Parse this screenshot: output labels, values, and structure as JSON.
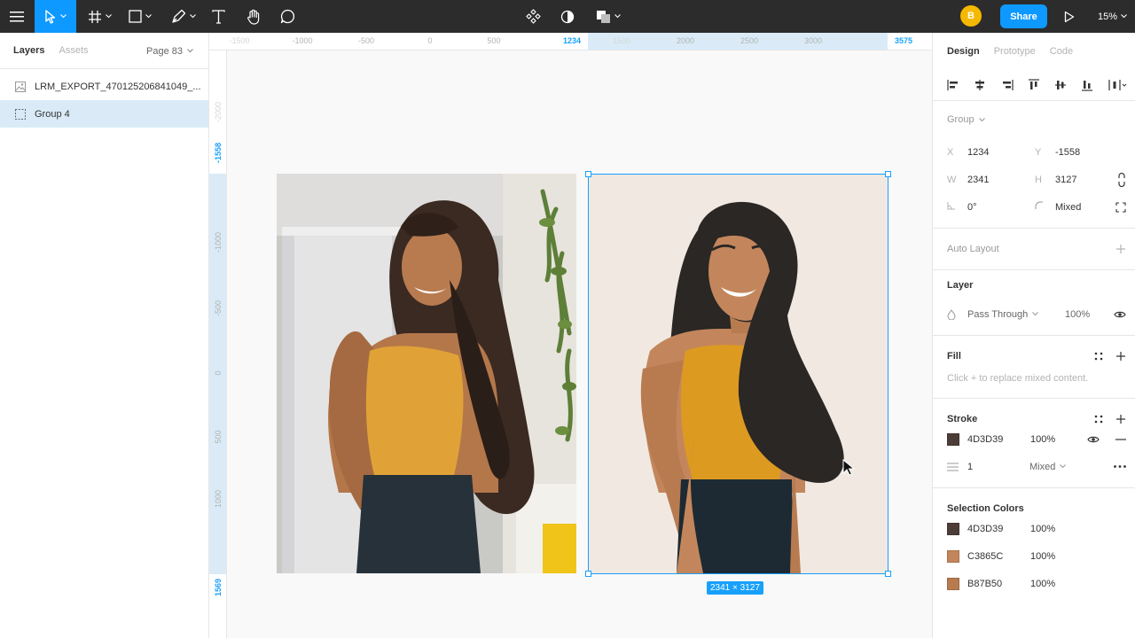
{
  "toolbar": {
    "avatar_initial": "B",
    "share_label": "Share",
    "zoom": "15%"
  },
  "left_panel": {
    "tabs": [
      {
        "label": "Layers"
      },
      {
        "label": "Assets"
      }
    ],
    "page": "Page 83",
    "layers": [
      {
        "label": "LRM_EXPORT_470125206841049_...",
        "icon": "image-icon"
      },
      {
        "label": "Group 4",
        "icon": "group-icon"
      }
    ]
  },
  "ruler_top": {
    "labels": [
      "-1500",
      "-1000",
      "-500",
      "0",
      "500",
      "1500",
      "2000",
      "2500",
      "3000"
    ],
    "sel_start": "1234",
    "sel_end": "3575"
  },
  "ruler_left": {
    "labels": [
      "-2000",
      "-1000",
      "-500",
      "0",
      "500",
      "1000"
    ],
    "sel_start": "-1558",
    "sel_end": "1569"
  },
  "canvas": {
    "selection_size": "2341 × 3127",
    "colors": {
      "illustration_bg": "#f1e9e1",
      "skin": "#c3865c",
      "skin_shadow": "#b87b50",
      "hair": "#2a2725",
      "top": "#dd9a20",
      "jeans": "#1d2a33"
    }
  },
  "right_panel": {
    "tabs": [
      {
        "label": "Design"
      },
      {
        "label": "Prototype"
      },
      {
        "label": "Code"
      }
    ],
    "group_label": "Group",
    "x_label": "X",
    "x": "1234",
    "y_label": "Y",
    "y": "-1558",
    "w_label": "W",
    "w": "2341",
    "h_label": "H",
    "h": "3127",
    "rotation": "0°",
    "radius": "Mixed",
    "auto_layout": "Auto Layout",
    "layer": {
      "title": "Layer",
      "blend": "Pass Through",
      "opacity": "100%"
    },
    "fill": {
      "title": "Fill",
      "hint": "Click + to replace mixed content."
    },
    "stroke": {
      "title": "Stroke",
      "hex": "4D3D39",
      "opacity": "100%",
      "color": "#4d3d39",
      "weight": "1",
      "position": "Mixed"
    },
    "selection_colors": {
      "title": "Selection Colors",
      "items": [
        {
          "hex": "4D3D39",
          "opacity": "100%",
          "color": "#4d3d39"
        },
        {
          "hex": "C3865C",
          "opacity": "100%",
          "color": "#c3865c"
        },
        {
          "hex": "B87B50",
          "opacity": "100%",
          "color": "#b87b50"
        }
      ]
    }
  }
}
